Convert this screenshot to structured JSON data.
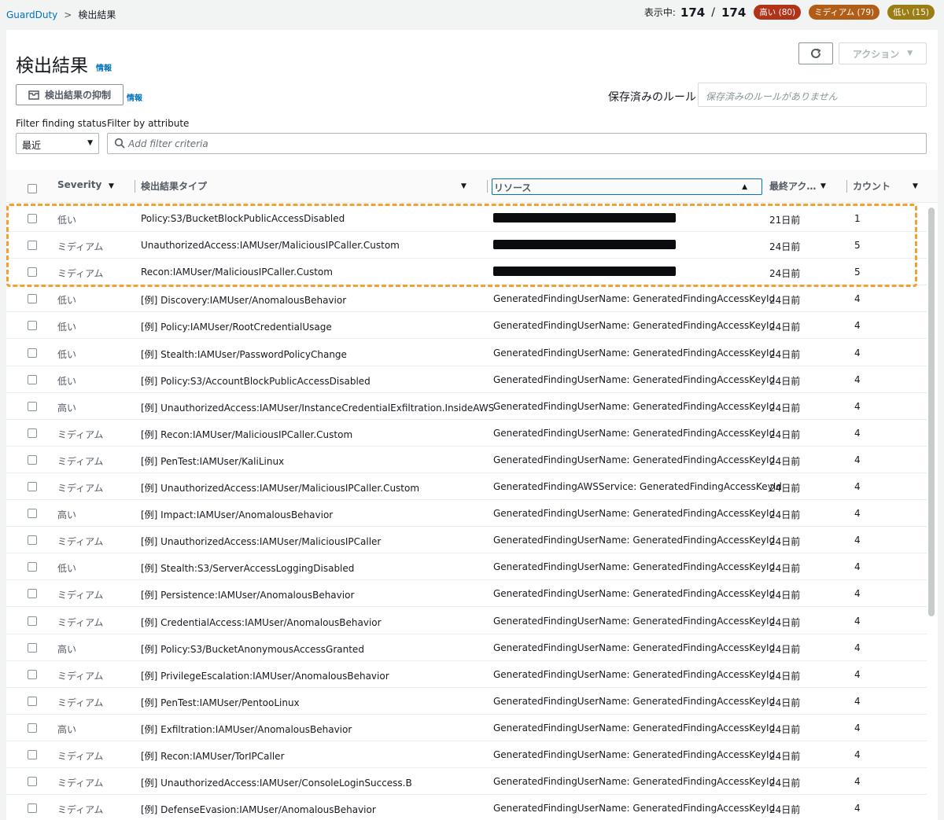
{
  "breadcrumb": {
    "service": "GuardDuty",
    "current": "検出結果"
  },
  "counts": {
    "label": "表示中:",
    "shown": "174",
    "total": "174",
    "high": "高い (80)",
    "medium": "ミディアム (79)",
    "low": "低い (15)"
  },
  "colors": {
    "accent": "#0073bb",
    "high": "#b0341a",
    "medium": "#b25d17",
    "low": "#9b7d15",
    "highlight": "#f49f31"
  },
  "page": {
    "title": "検出結果",
    "info": "情報"
  },
  "toolbar": {
    "refresh_icon": "refresh-icon",
    "action_label": "アクション",
    "suppress_label": "検出結果の抑制",
    "suppress_info": "情報"
  },
  "saved_rules": {
    "label": "保存済みのルール",
    "placeholder": "保存済みのルールがありません"
  },
  "filters": {
    "status_label": "Filter finding status",
    "status_value": "最近",
    "attr_label": "Filter by attribute",
    "attr_placeholder": "Add filter criteria"
  },
  "table": {
    "headers": {
      "severity": "Severity",
      "type": "検出結果タイプ",
      "resource": "リソース",
      "age": "最終アク…",
      "count": "カウント"
    },
    "rows": [
      {
        "sev": "低い",
        "type": "Policy:S3/BucketBlockPublicAccessDisabled",
        "res": "",
        "age": "21日前",
        "cnt": "1"
      },
      {
        "sev": "ミディアム",
        "type": "UnauthorizedAccess:IAMUser/MaliciousIPCaller.Custom",
        "res": "",
        "age": "24日前",
        "cnt": "5"
      },
      {
        "sev": "ミディアム",
        "type": "Recon:IAMUser/MaliciousIPCaller.Custom",
        "res": "",
        "age": "24日前",
        "cnt": "5"
      },
      {
        "sev": "低い",
        "type": "[例] Discovery:IAMUser/AnomalousBehavior",
        "res": "GeneratedFindingUserName: GeneratedFindingAccessKeyId",
        "age": "24日前",
        "cnt": "4"
      },
      {
        "sev": "低い",
        "type": "[例] Policy:IAMUser/RootCredentialUsage",
        "res": "GeneratedFindingUserName: GeneratedFindingAccessKeyId",
        "age": "24日前",
        "cnt": "4"
      },
      {
        "sev": "低い",
        "type": "[例] Stealth:IAMUser/PasswordPolicyChange",
        "res": "GeneratedFindingUserName: GeneratedFindingAccessKeyId",
        "age": "24日前",
        "cnt": "4"
      },
      {
        "sev": "低い",
        "type": "[例] Policy:S3/AccountBlockPublicAccessDisabled",
        "res": "GeneratedFindingUserName: GeneratedFindingAccessKeyId",
        "age": "24日前",
        "cnt": "4"
      },
      {
        "sev": "高い",
        "type": "[例] UnauthorizedAccess:IAMUser/InstanceCredentialExfiltration.InsideAWS",
        "res": "GeneratedFindingUserName: GeneratedFindingAccessKeyId",
        "age": "24日前",
        "cnt": "4"
      },
      {
        "sev": "ミディアム",
        "type": "[例] Recon:IAMUser/MaliciousIPCaller.Custom",
        "res": "GeneratedFindingUserName: GeneratedFindingAccessKeyId",
        "age": "24日前",
        "cnt": "4"
      },
      {
        "sev": "ミディアム",
        "type": "[例] PenTest:IAMUser/KaliLinux",
        "res": "GeneratedFindingUserName: GeneratedFindingAccessKeyId",
        "age": "24日前",
        "cnt": "4"
      },
      {
        "sev": "ミディアム",
        "type": "[例] UnauthorizedAccess:IAMUser/MaliciousIPCaller.Custom",
        "res": "GeneratedFindingAWSService: GeneratedFindingAccessKeyId",
        "age": "24日前",
        "cnt": "4"
      },
      {
        "sev": "高い",
        "type": "[例] Impact:IAMUser/AnomalousBehavior",
        "res": "GeneratedFindingUserName: GeneratedFindingAccessKeyId",
        "age": "24日前",
        "cnt": "4"
      },
      {
        "sev": "ミディアム",
        "type": "[例] UnauthorizedAccess:IAMUser/MaliciousIPCaller",
        "res": "GeneratedFindingUserName: GeneratedFindingAccessKeyId",
        "age": "24日前",
        "cnt": "4"
      },
      {
        "sev": "低い",
        "type": "[例] Stealth:S3/ServerAccessLoggingDisabled",
        "res": "GeneratedFindingUserName: GeneratedFindingAccessKeyId",
        "age": "24日前",
        "cnt": "4"
      },
      {
        "sev": "ミディアム",
        "type": "[例] Persistence:IAMUser/AnomalousBehavior",
        "res": "GeneratedFindingUserName: GeneratedFindingAccessKeyId",
        "age": "24日前",
        "cnt": "4"
      },
      {
        "sev": "ミディアム",
        "type": "[例] CredentialAccess:IAMUser/AnomalousBehavior",
        "res": "GeneratedFindingUserName: GeneratedFindingAccessKeyId",
        "age": "24日前",
        "cnt": "4"
      },
      {
        "sev": "高い",
        "type": "[例] Policy:S3/BucketAnonymousAccessGranted",
        "res": "GeneratedFindingUserName: GeneratedFindingAccessKeyId",
        "age": "24日前",
        "cnt": "4"
      },
      {
        "sev": "ミディアム",
        "type": "[例] PrivilegeEscalation:IAMUser/AnomalousBehavior",
        "res": "GeneratedFindingUserName: GeneratedFindingAccessKeyId",
        "age": "24日前",
        "cnt": "4"
      },
      {
        "sev": "ミディアム",
        "type": "[例] PenTest:IAMUser/PentooLinux",
        "res": "GeneratedFindingUserName: GeneratedFindingAccessKeyId",
        "age": "24日前",
        "cnt": "4"
      },
      {
        "sev": "高い",
        "type": "[例] Exfiltration:IAMUser/AnomalousBehavior",
        "res": "GeneratedFindingUserName: GeneratedFindingAccessKeyId",
        "age": "24日前",
        "cnt": "4"
      },
      {
        "sev": "ミディアム",
        "type": "[例] Recon:IAMUser/TorIPCaller",
        "res": "GeneratedFindingUserName: GeneratedFindingAccessKeyId",
        "age": "24日前",
        "cnt": "4"
      },
      {
        "sev": "ミディアム",
        "type": "[例] UnauthorizedAccess:IAMUser/ConsoleLoginSuccess.B",
        "res": "GeneratedFindingUserName: GeneratedFindingAccessKeyId",
        "age": "24日前",
        "cnt": "4"
      },
      {
        "sev": "ミディアム",
        "type": "[例] DefenseEvasion:IAMUser/AnomalousBehavior",
        "res": "GeneratedFindingUserName: GeneratedFindingAccessKeyId",
        "age": "24日前",
        "cnt": "4"
      }
    ]
  }
}
